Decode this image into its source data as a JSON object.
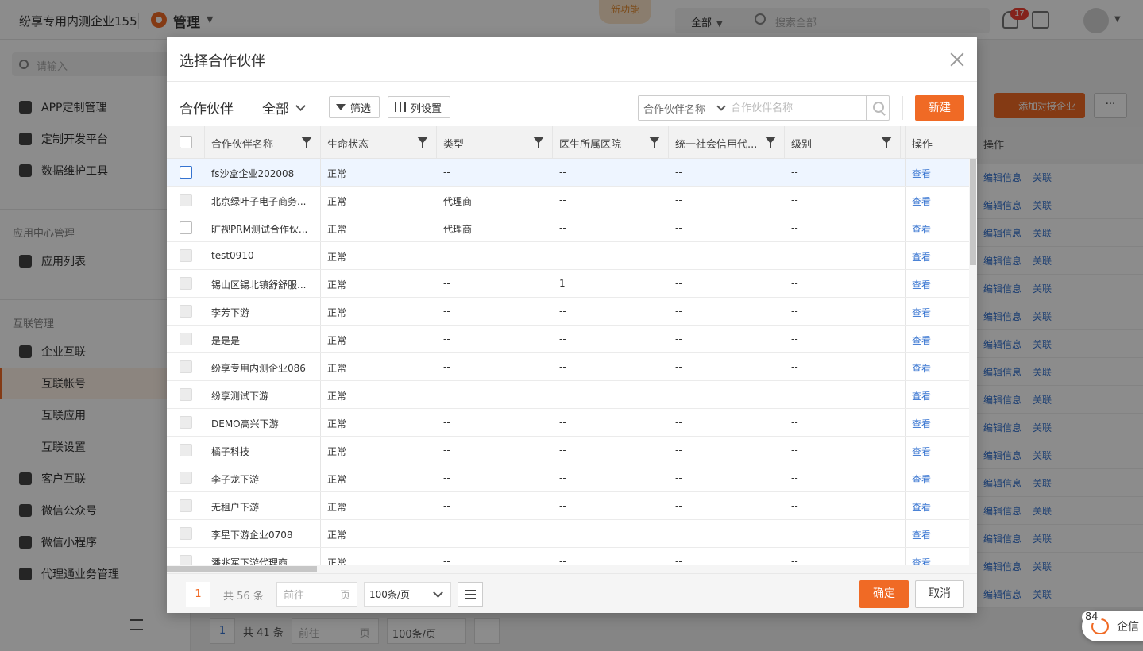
{
  "topbar": {
    "org_name": "纷享专用内测企业155",
    "module_label": "管理",
    "new_feature_tab": "新功能",
    "search_scope": "全部",
    "search_placeholder": "搜索全部",
    "notification_count": "17",
    "icons": [
      "manage-icon",
      "search-icon",
      "bell-icon",
      "inbox-icon",
      "avatar"
    ]
  },
  "sidebar": {
    "search_placeholder": "请输入",
    "items": [
      {
        "label": "APP定制管理",
        "icon": "app-custom-icon"
      },
      {
        "label": "定制开发平台",
        "icon": "dev-platform-icon"
      },
      {
        "label": "数据维护工具",
        "icon": "data-tool-icon"
      }
    ],
    "section_app_center": "应用中心管理",
    "app_list": "应用列表",
    "section_interconnect": "互联管理",
    "enterprise_interconnect": "企业互联",
    "sub_items": [
      "互联帐号",
      "互联应用",
      "互联设置"
    ],
    "more_items": [
      "客户互联",
      "微信公众号",
      "微信小程序",
      "代理通业务管理"
    ]
  },
  "background_main": {
    "add_button": "添加对接企业",
    "more_button": "···",
    "op_header": "操作",
    "op_edit": "编辑信息",
    "op_link": "关联",
    "pager": {
      "page": "1",
      "total": "共 41 条",
      "goto_prefix": "前往",
      "goto_suffix": "页",
      "page_size": "100条/页"
    }
  },
  "qixin": {
    "badge": "84",
    "label": "企信"
  },
  "modal": {
    "title": "选择合作伙伴",
    "toolbar": {
      "object_name": "合作伙伴",
      "scope": "全部",
      "filter_label": "筛选",
      "columns_label": "列设置",
      "search_field": "合作伙伴名称",
      "search_placeholder": "合作伙伴名称",
      "new_label": "新建"
    },
    "columns": [
      "合作伙伴名称",
      "生命状态",
      "类型",
      "医生所属医院",
      "统一社会信用代...",
      "级别",
      "操作"
    ],
    "rows": [
      {
        "name": "fs沙盒企业202008",
        "status": "正常",
        "type": "--",
        "hospital": "--",
        "credit": "--",
        "level": "--",
        "action": "查看"
      },
      {
        "name": "北京绿叶子电子商务...",
        "status": "正常",
        "type": "代理商",
        "hospital": "--",
        "credit": "--",
        "level": "--",
        "action": "查看"
      },
      {
        "name": "旷视PRM测试合作伙...",
        "status": "正常",
        "type": "代理商",
        "hospital": "--",
        "credit": "--",
        "level": "--",
        "action": "查看"
      },
      {
        "name": "test0910",
        "status": "正常",
        "type": "--",
        "hospital": "--",
        "credit": "--",
        "level": "--",
        "action": "查看"
      },
      {
        "name": "锡山区锡北镇舒舒服...",
        "status": "正常",
        "type": "--",
        "hospital": "1",
        "credit": "--",
        "level": "--",
        "action": "查看"
      },
      {
        "name": "李芳下游",
        "status": "正常",
        "type": "--",
        "hospital": "--",
        "credit": "--",
        "level": "--",
        "action": "查看"
      },
      {
        "name": "是是是",
        "status": "正常",
        "type": "--",
        "hospital": "--",
        "credit": "--",
        "level": "--",
        "action": "查看"
      },
      {
        "name": "纷享专用内测企业086",
        "status": "正常",
        "type": "--",
        "hospital": "--",
        "credit": "--",
        "level": "--",
        "action": "查看"
      },
      {
        "name": "纷享测试下游",
        "status": "正常",
        "type": "--",
        "hospital": "--",
        "credit": "--",
        "level": "--",
        "action": "查看"
      },
      {
        "name": "DEMO高兴下游",
        "status": "正常",
        "type": "--",
        "hospital": "--",
        "credit": "--",
        "level": "--",
        "action": "查看"
      },
      {
        "name": "橘子科技",
        "status": "正常",
        "type": "--",
        "hospital": "--",
        "credit": "--",
        "level": "--",
        "action": "查看"
      },
      {
        "name": "李子龙下游",
        "status": "正常",
        "type": "--",
        "hospital": "--",
        "credit": "--",
        "level": "--",
        "action": "查看"
      },
      {
        "name": "无租户下游",
        "status": "正常",
        "type": "--",
        "hospital": "--",
        "credit": "--",
        "level": "--",
        "action": "查看"
      },
      {
        "name": "李星下游企业0708",
        "status": "正常",
        "type": "--",
        "hospital": "--",
        "credit": "--",
        "level": "--",
        "action": "查看"
      },
      {
        "name": "潘兆军下游代理商",
        "status": "正常",
        "type": "--",
        "hospital": "--",
        "credit": "--",
        "level": "--",
        "action": "查看"
      }
    ],
    "row_checkbox_state": [
      "hover",
      "disabled",
      "enabled",
      "disabled",
      "disabled",
      "disabled",
      "disabled",
      "disabled",
      "disabled",
      "disabled",
      "disabled",
      "disabled",
      "disabled",
      "disabled",
      "disabled"
    ],
    "pager": {
      "page": "1",
      "total": "共 56 条",
      "goto_prefix": "前往",
      "goto_suffix": "页",
      "page_size": "100条/页"
    },
    "ok_label": "确定",
    "cancel_label": "取消",
    "accent_color": "#f06a25",
    "link_color": "#3573d0"
  }
}
